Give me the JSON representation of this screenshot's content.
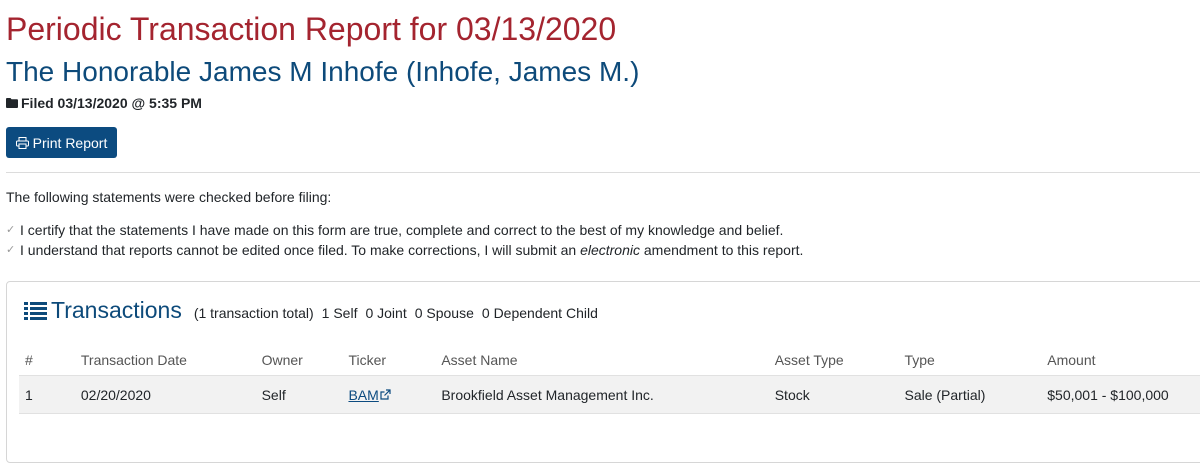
{
  "header": {
    "title": "Periodic Transaction Report for 03/13/2020",
    "member": "The Honorable James M Inhofe (Inhofe, James M.)",
    "filed": "Filed 03/13/2020 @ 5:35 PM",
    "print_label": "Print Report"
  },
  "statements": {
    "intro": "The following statements were checked before filing:",
    "cert_1": "I certify that the statements I have made on this form are true, complete and correct to the best of my knowledge and belief.",
    "cert_2_before": "I understand that reports cannot be edited once filed. To make corrections, I will submit an ",
    "cert_2_em": "electronic",
    "cert_2_after": " amendment to this report.",
    "check_glyph": "✓"
  },
  "transactions": {
    "title": "Transactions",
    "total": "(1 transaction total)",
    "self": "1 Self",
    "joint": "0 Joint",
    "spouse": "0 Spouse",
    "dependent": "0 Dependent Child",
    "columns": [
      "#",
      "Transaction Date",
      "Owner",
      "Ticker",
      "Asset Name",
      "Asset Type",
      "Type",
      "Amount"
    ],
    "rows": [
      {
        "num": "1",
        "date": "02/20/2020",
        "owner": "Self",
        "ticker": "BAM",
        "asset_name": "Brookfield Asset Management Inc.",
        "asset_type": "Stock",
        "type": "Sale (Partial)",
        "amount": "$50,001 - $100,000"
      }
    ]
  },
  "icons": {
    "filed": "folder-icon",
    "print": "print-icon",
    "transactions": "list-icon",
    "ticker": "external-link-icon",
    "check": "check-icon"
  },
  "colors": {
    "title_red": "#a4242f",
    "heading_blue": "#0d4a7a",
    "button_blue": "#0c4b80"
  }
}
